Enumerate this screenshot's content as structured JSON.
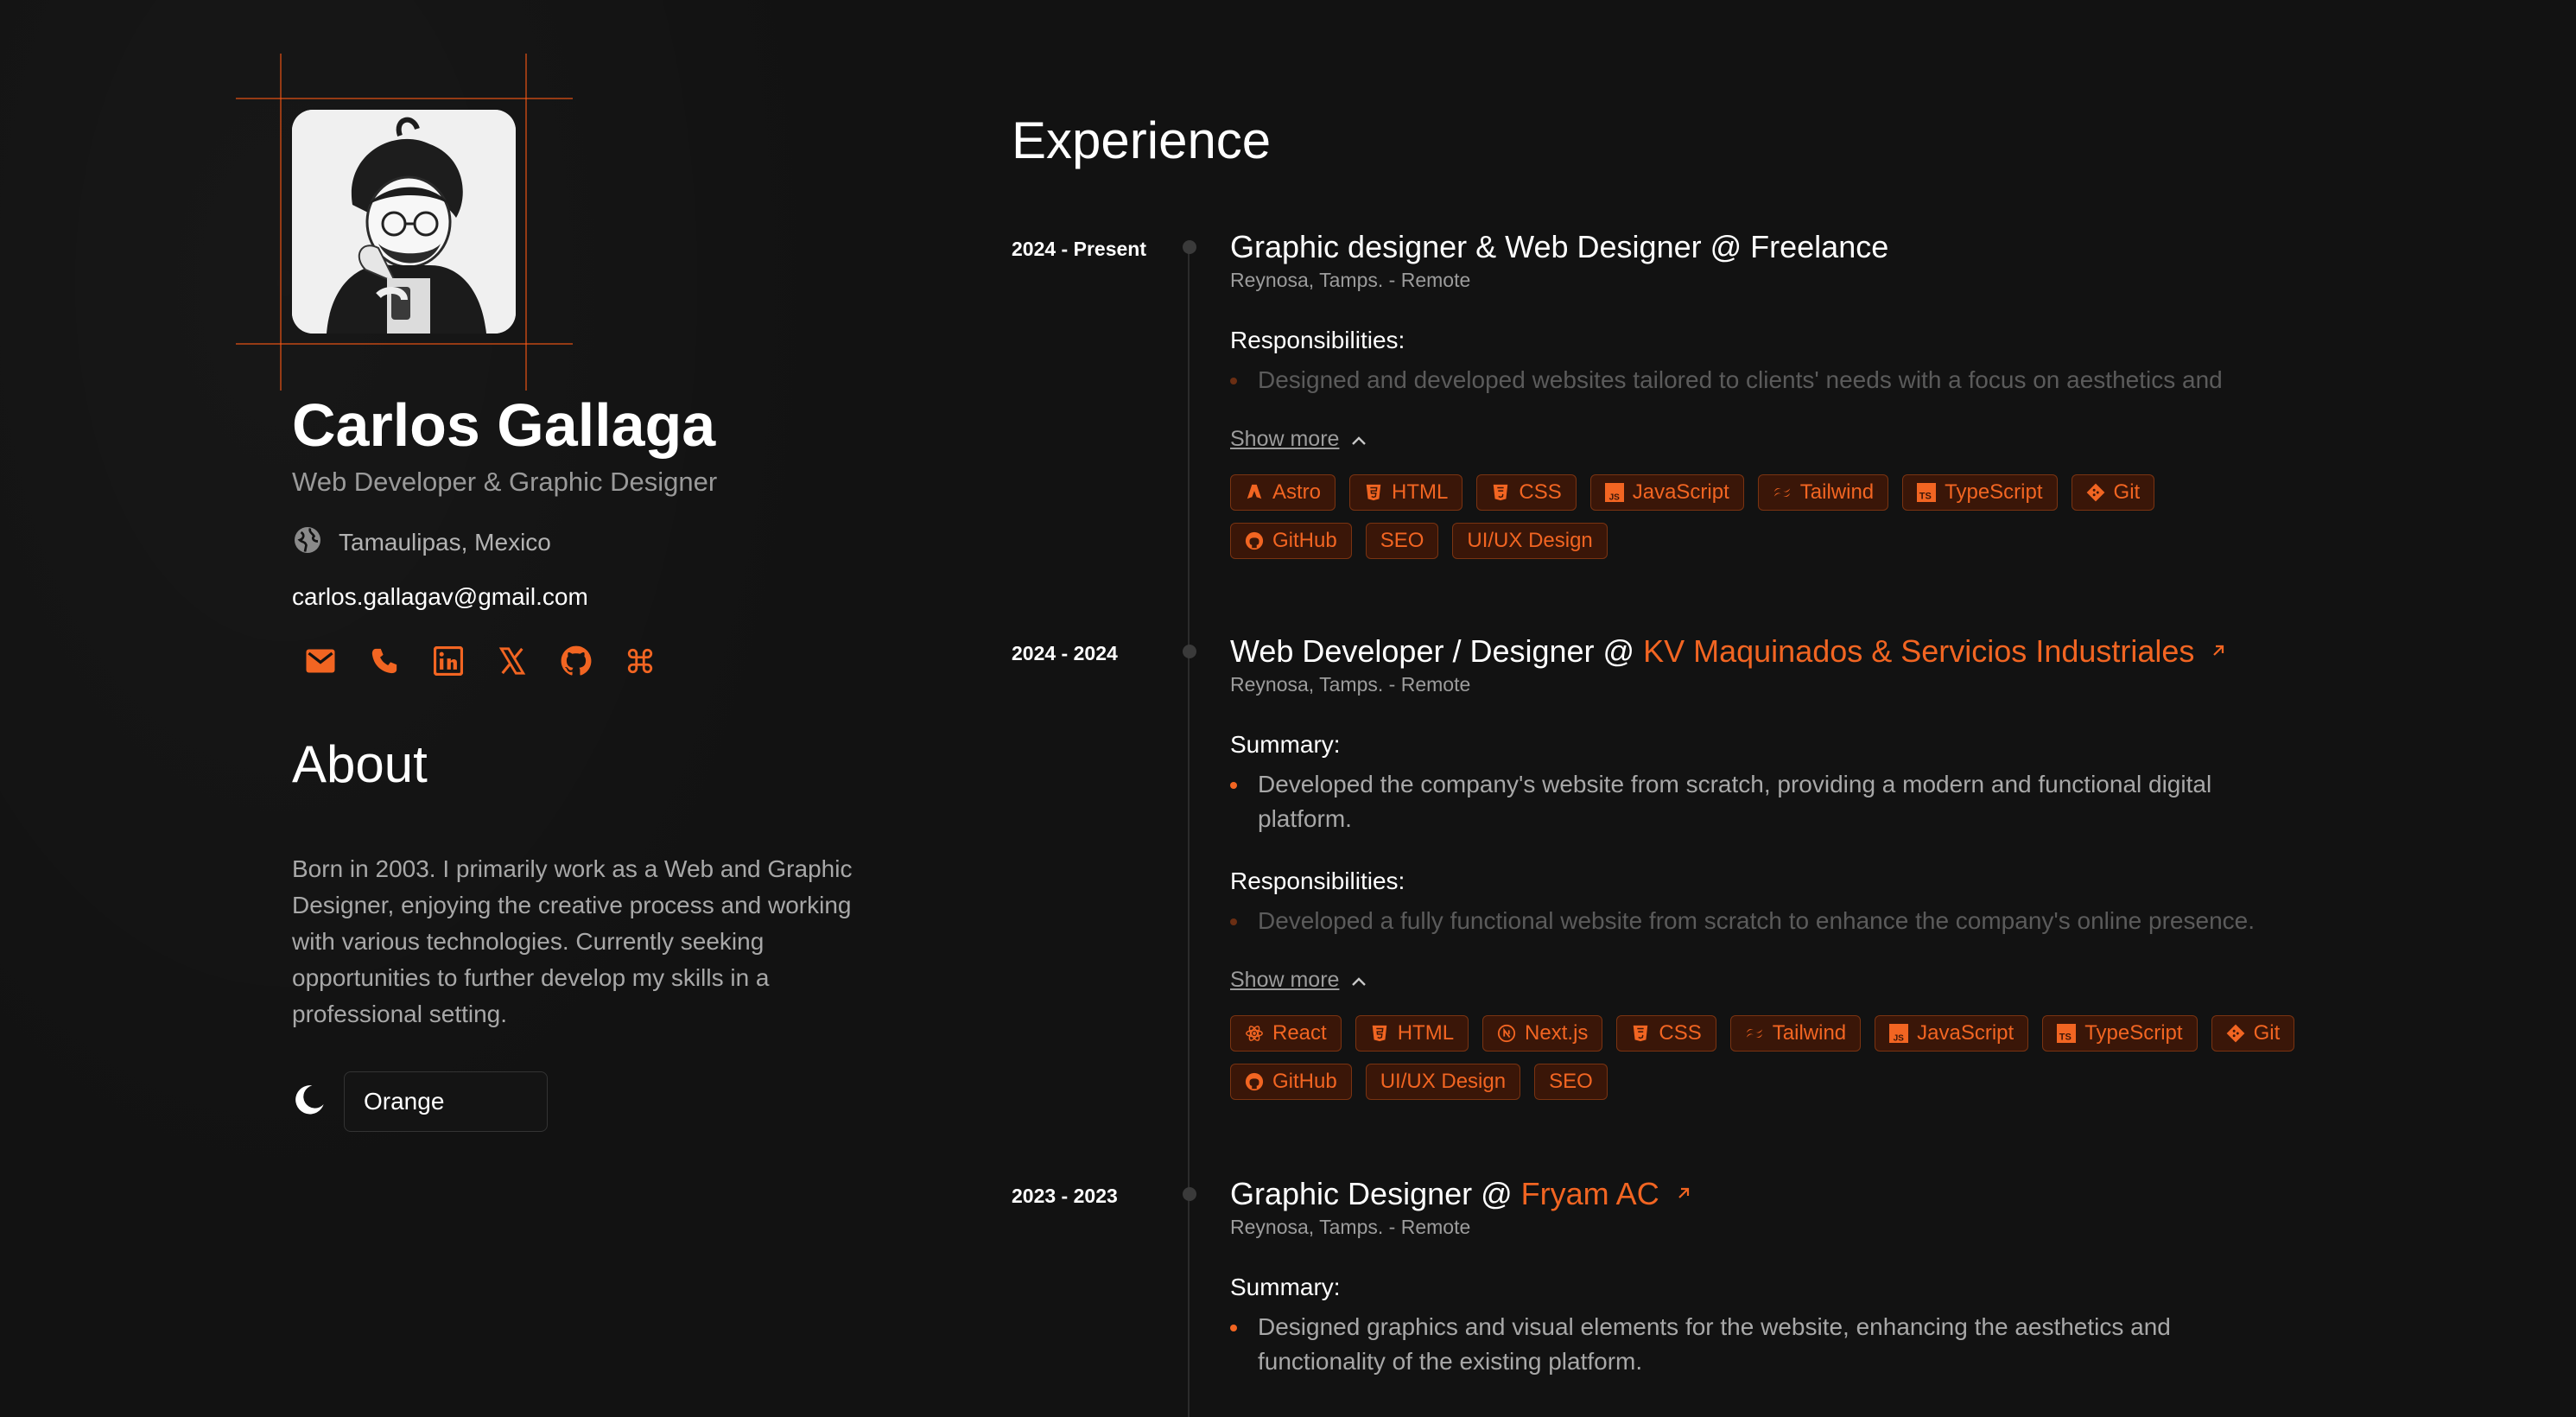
{
  "profile": {
    "name": "Carlos Gallaga",
    "role": "Web Developer & Graphic Designer",
    "location": "Tamaulipas, Mexico",
    "email": "carlos.gallagav@gmail.com",
    "socials": [
      "mail-icon",
      "phone-icon",
      "linkedin-icon",
      "x-icon",
      "github-icon",
      "command-icon"
    ]
  },
  "about": {
    "heading": "About",
    "text": "Born in 2003. I primarily work as a Web and Graphic Designer, enjoying the creative process and working with various technologies. Currently seeking opportunities to further develop my skills in a professional setting."
  },
  "theme": {
    "selected": "Orange"
  },
  "experience": {
    "heading": "Experience",
    "entries": [
      {
        "date": "2024 - Present",
        "title": "Graphic designer & Web Designer @ Freelance",
        "company": "",
        "location": "Reynosa, Tamps. - Remote",
        "summary_label": "",
        "summary": "",
        "resp_label": "Responsibilities:",
        "resp": "Designed and developed websites tailored to clients' needs with a focus on aesthetics and",
        "show_more": "Show more",
        "tags": [
          "Astro",
          "HTML",
          "CSS",
          "JavaScript",
          "Tailwind",
          "TypeScript",
          "Git",
          "GitHub",
          "SEO",
          "UI/UX Design"
        ]
      },
      {
        "date": "2024 - 2024",
        "title": "Web Developer / Designer @",
        "company": "KV Maquinados & Servicios Industriales",
        "location": "Reynosa, Tamps. - Remote",
        "summary_label": "Summary:",
        "summary": "Developed the company's website from scratch, providing a modern and functional digital platform.",
        "resp_label": "Responsibilities:",
        "resp": "Developed a fully functional website from scratch to enhance the company's online presence.",
        "show_more": "Show more",
        "tags": [
          "React",
          "HTML",
          "Next.js",
          "CSS",
          "Tailwind",
          "JavaScript",
          "TypeScript",
          "Git",
          "GitHub",
          "UI/UX Design",
          "SEO"
        ]
      },
      {
        "date": "2023 - 2023",
        "title": "Graphic Designer @",
        "company": "Fryam AC",
        "location": "Reynosa, Tamps. - Remote",
        "summary_label": "Summary:",
        "summary": "Designed graphics and visual elements for the website, enhancing the aesthetics and functionality of the existing platform."
      }
    ]
  },
  "colors": {
    "accent": "#f26522",
    "background": "#121212"
  }
}
